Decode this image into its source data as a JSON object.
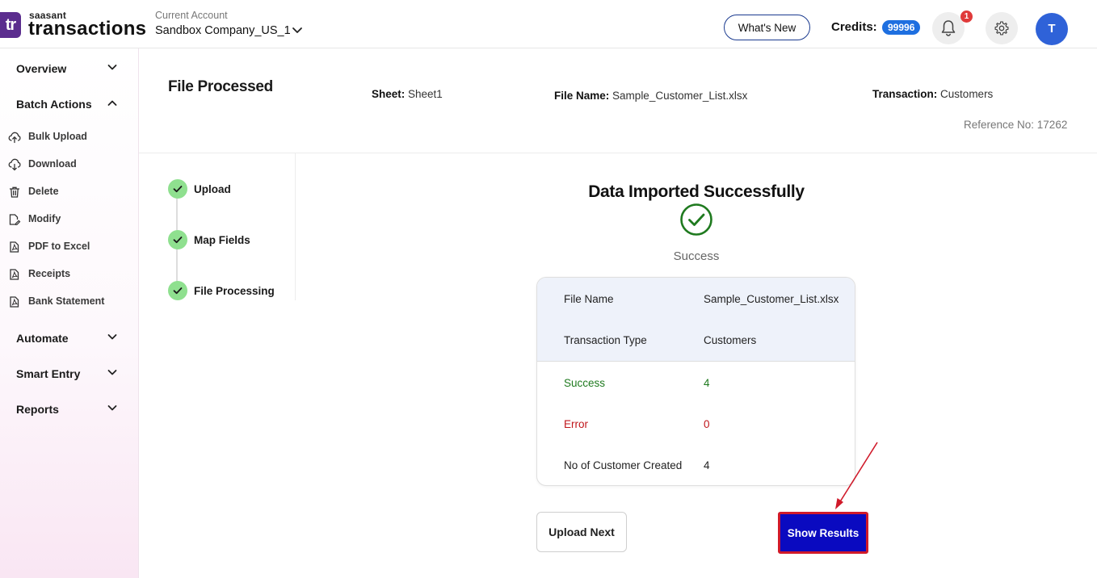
{
  "header": {
    "logo_mark": "tr",
    "logo_small": "saasant",
    "logo_big": "transactions",
    "account_label": "Current Account",
    "account_name": "Sandbox Company_US_1",
    "whats_new": "What's New",
    "credits_label": "Credits:",
    "credits_value": "99996",
    "notification_count": "1",
    "avatar_initial": "T"
  },
  "sidebar": {
    "overview": "Overview",
    "batch_actions": "Batch Actions",
    "items": [
      {
        "label": "Bulk Upload",
        "icon": "cloud-upload-icon"
      },
      {
        "label": "Download",
        "icon": "cloud-download-icon"
      },
      {
        "label": "Delete",
        "icon": "trash-icon"
      },
      {
        "label": "Modify",
        "icon": "edit-file-icon"
      },
      {
        "label": "PDF to Excel",
        "icon": "pdf-file-icon"
      },
      {
        "label": "Receipts",
        "icon": "receipt-file-icon"
      },
      {
        "label": "Bank Statement",
        "icon": "statement-file-icon"
      }
    ],
    "automate": "Automate",
    "smart_entry": "Smart Entry",
    "reports": "Reports"
  },
  "page": {
    "title": "File Processed",
    "sheet_label": "Sheet:",
    "sheet_value": "Sheet1",
    "file_name_label": "File Name:",
    "file_name_value": "Sample_Customer_List.xlsx",
    "transaction_label": "Transaction:",
    "transaction_value": "Customers",
    "reference": "Reference No: 17262"
  },
  "steps": [
    "Upload",
    "Map Fields",
    "File Processing"
  ],
  "result": {
    "title": "Data Imported Successfully",
    "status": "Success",
    "rows": [
      {
        "key": "File Name",
        "value": "Sample_Customer_List.xlsx"
      },
      {
        "key": "Transaction Type",
        "value": "Customers"
      },
      {
        "key": "Success",
        "value": "4"
      },
      {
        "key": "Error",
        "value": "0"
      },
      {
        "key": "No of Customer Created",
        "value": "4"
      }
    ],
    "upload_next": "Upload Next",
    "show_results": "Show Results"
  },
  "colors": {
    "brand": "#5b2d8e",
    "primary_button": "#0a0ac0",
    "success": "#1f7a1f",
    "error": "#c0161b",
    "highlight_border": "#d01a2a"
  }
}
